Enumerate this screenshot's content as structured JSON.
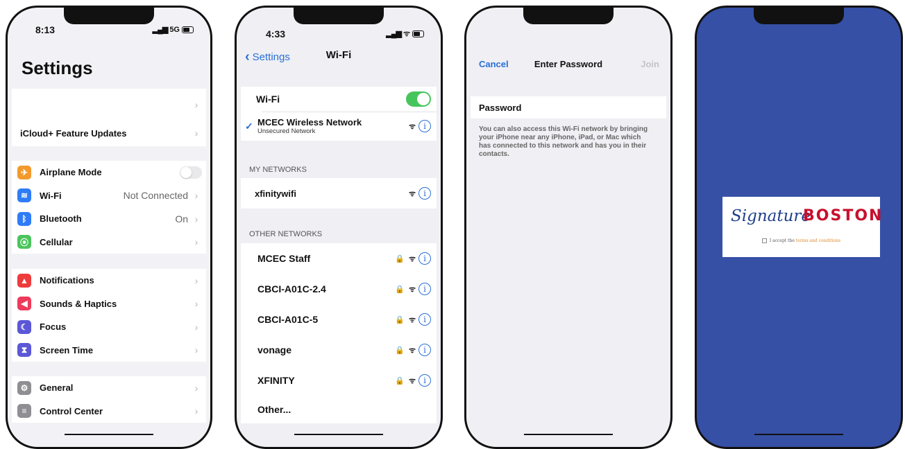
{
  "phone1": {
    "time": "8:13",
    "status": "5G",
    "title": "Settings",
    "group1": [
      {
        "label": ""
      },
      {
        "label": "iCloud+ Feature Updates"
      }
    ],
    "group2": [
      {
        "label": "Airplane Mode",
        "icon": "airplane-icon",
        "color": "#f29a2e",
        "glyph": "✈"
      },
      {
        "label": "Wi-Fi",
        "value": "Not Connected",
        "icon": "wifi-icon",
        "color": "#2f7cf6",
        "glyph": "≋"
      },
      {
        "label": "Bluetooth",
        "value": "On",
        "icon": "bluetooth-icon",
        "color": "#2f7cf6",
        "glyph": "ᛒ"
      },
      {
        "label": "Cellular",
        "icon": "cellular-icon",
        "color": "#4bc45c",
        "glyph": "⦿"
      }
    ],
    "group3": [
      {
        "label": "Notifications",
        "icon": "bell-icon",
        "color": "#ee3b3b",
        "glyph": "▲"
      },
      {
        "label": "Sounds & Haptics",
        "icon": "speaker-icon",
        "color": "#ee3b5b",
        "glyph": "◀"
      },
      {
        "label": "Focus",
        "icon": "moon-icon",
        "color": "#5b57d6",
        "glyph": "☾"
      },
      {
        "label": "Screen Time",
        "icon": "hourglass-icon",
        "color": "#5b57d6",
        "glyph": "⧗"
      }
    ],
    "group4": [
      {
        "label": "General",
        "icon": "gear-icon",
        "color": "#8e8e93",
        "glyph": "⚙"
      },
      {
        "label": "Control Center",
        "icon": "switches-icon",
        "color": "#8e8e93",
        "glyph": "≡"
      }
    ]
  },
  "phone2": {
    "time": "4:33",
    "back": "Settings",
    "title": "Wi-Fi",
    "wifi_label": "Wi-Fi",
    "connected": {
      "name": "MCEC Wireless Network",
      "sub": "Unsecured Network"
    },
    "my_networks_header": "MY NETWORKS",
    "my_networks": [
      {
        "name": "xfinitywifi"
      }
    ],
    "other_networks_header": "OTHER NETWORKS",
    "other_networks": [
      {
        "name": "MCEC Staff"
      },
      {
        "name": "CBCI-A01C-2.4"
      },
      {
        "name": "CBCI-A01C-5"
      },
      {
        "name": "vonage"
      },
      {
        "name": "XFINITY"
      }
    ],
    "other_label": "Other..."
  },
  "phone3": {
    "cancel": "Cancel",
    "title": "Enter Password",
    "join": "Join",
    "field_label": "Password",
    "help": "You can also access this Wi-Fi network by bringing your iPhone near any iPhone, iPad, or Mac which has connected to this network and has you in their contacts."
  },
  "phone4": {
    "logo_script": "Signature",
    "logo_word": "BOSTON",
    "accept_prefix": "I accept the",
    "accept_link": "terms and conditions"
  }
}
